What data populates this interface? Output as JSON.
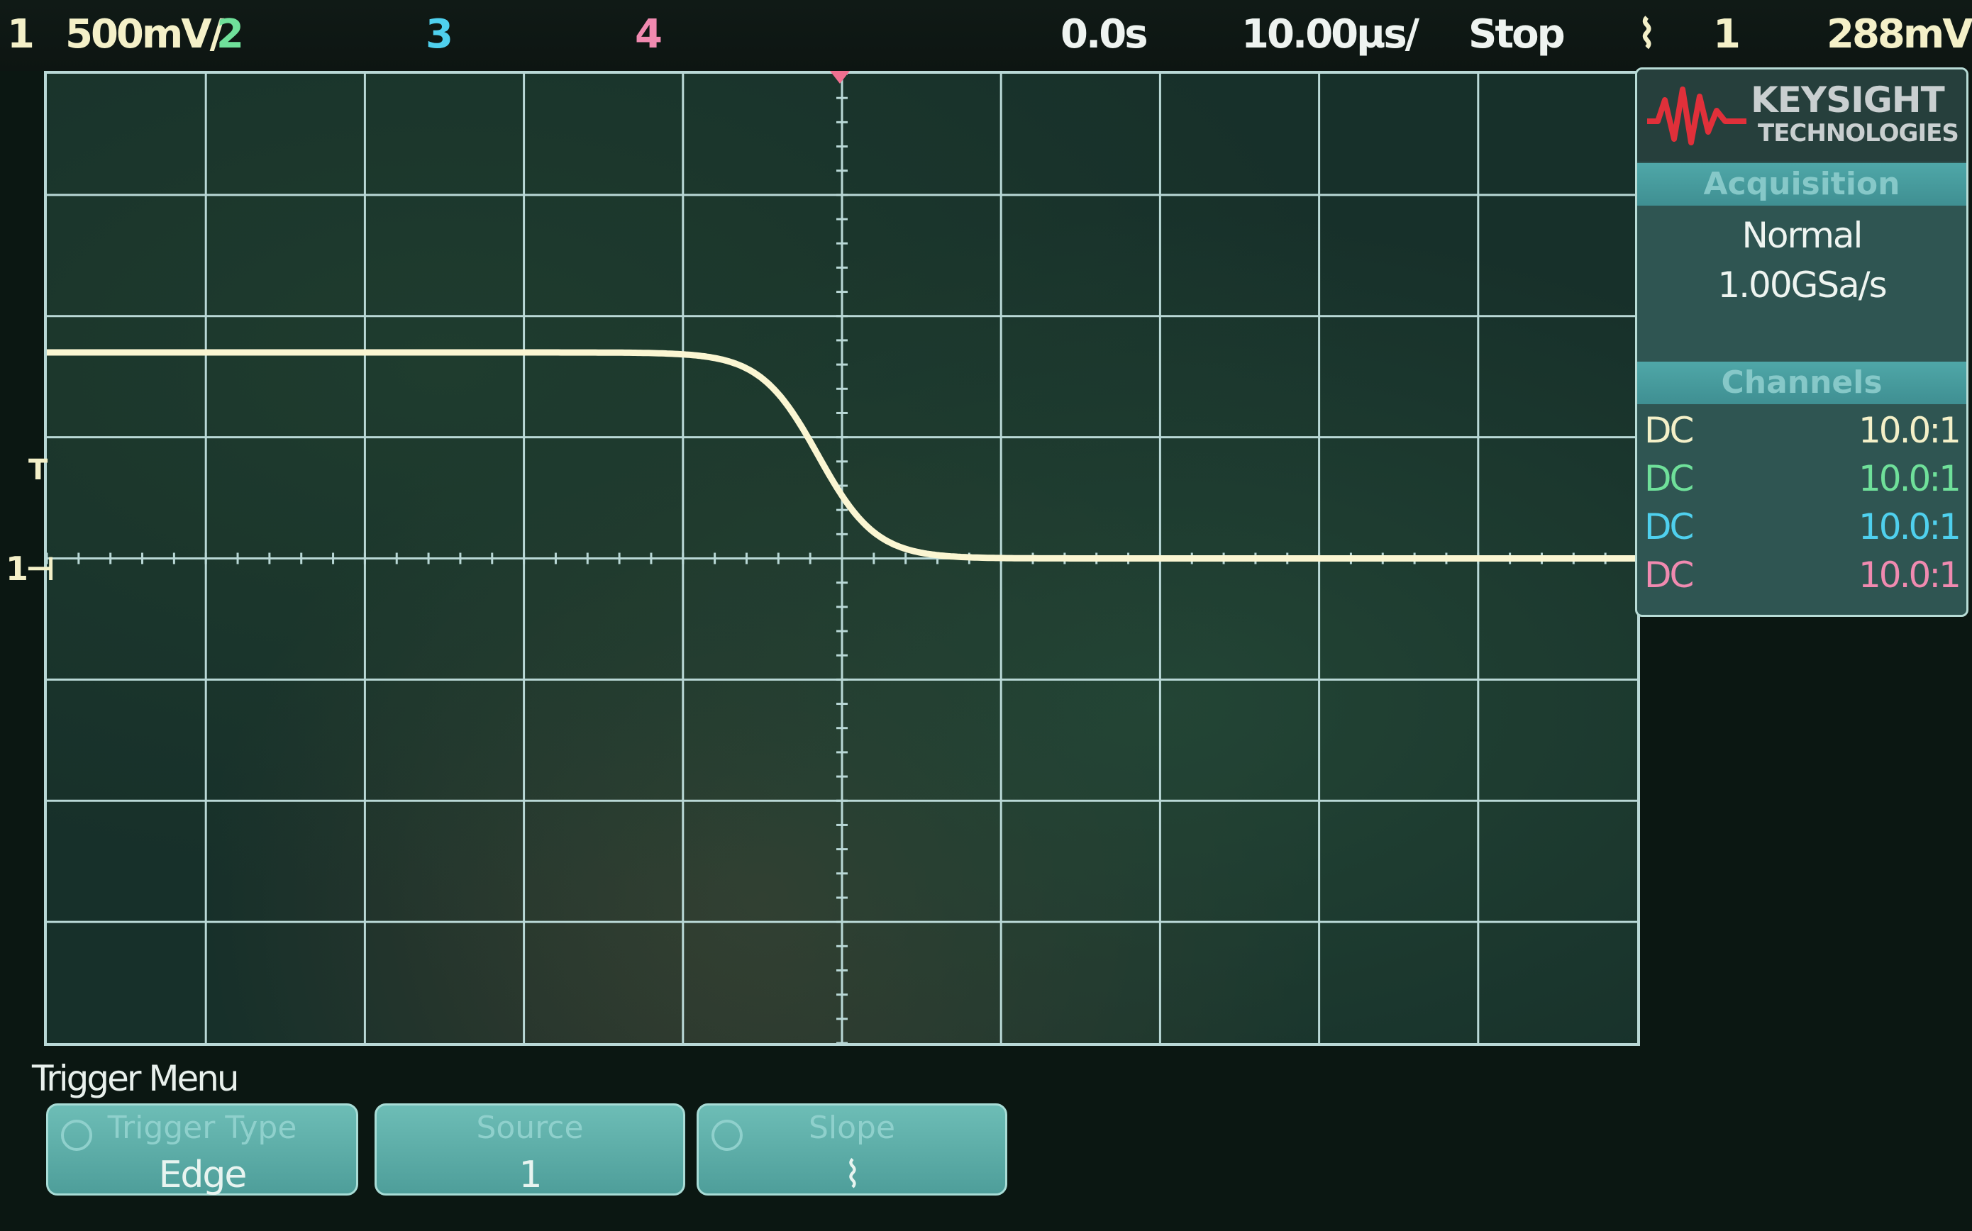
{
  "top_bar": {
    "ch1_number": "1",
    "ch1_scale": "500mV/",
    "ch2_number": "2",
    "ch3_number": "3",
    "ch4_number": "4",
    "delay": "0.0s",
    "timebase": "10.00µs/",
    "run_state": "Stop",
    "trigger_icon": "⌇",
    "trigger_source": "1",
    "trigger_level": "288mV"
  },
  "markers": {
    "ground": "1⊣",
    "trigger_level": "T"
  },
  "brand": {
    "name": "KEYSIGHT",
    "sub": "TECHNOLOGIES"
  },
  "acquisition": {
    "header": "Acquisition",
    "mode": "Normal",
    "rate": "1.00GSa/s"
  },
  "channels": {
    "header": "Channels",
    "rows": [
      {
        "coupling": "DC",
        "probe": "10.0:1",
        "color": "#f4f0c8"
      },
      {
        "coupling": "DC",
        "probe": "10.0:1",
        "color": "#6fe09a"
      },
      {
        "coupling": "DC",
        "probe": "10.0:1",
        "color": "#4fd0ee"
      },
      {
        "coupling": "DC",
        "probe": "10.0:1",
        "color": "#f08ab0"
      }
    ]
  },
  "menu": {
    "title": "Trigger Menu",
    "softkeys": [
      {
        "label": "Trigger Type",
        "value": "Edge"
      },
      {
        "label": "Source",
        "value": "1"
      },
      {
        "label": "Slope",
        "value": "⌇"
      }
    ]
  },
  "waveform": {
    "channel": "1",
    "color": "#fbf6d2",
    "high_divisions_above_ground": 1.7,
    "low_divisions_above_ground": 0.0,
    "transition_center_time_us": -1.5,
    "fall_time_us": 8
  }
}
